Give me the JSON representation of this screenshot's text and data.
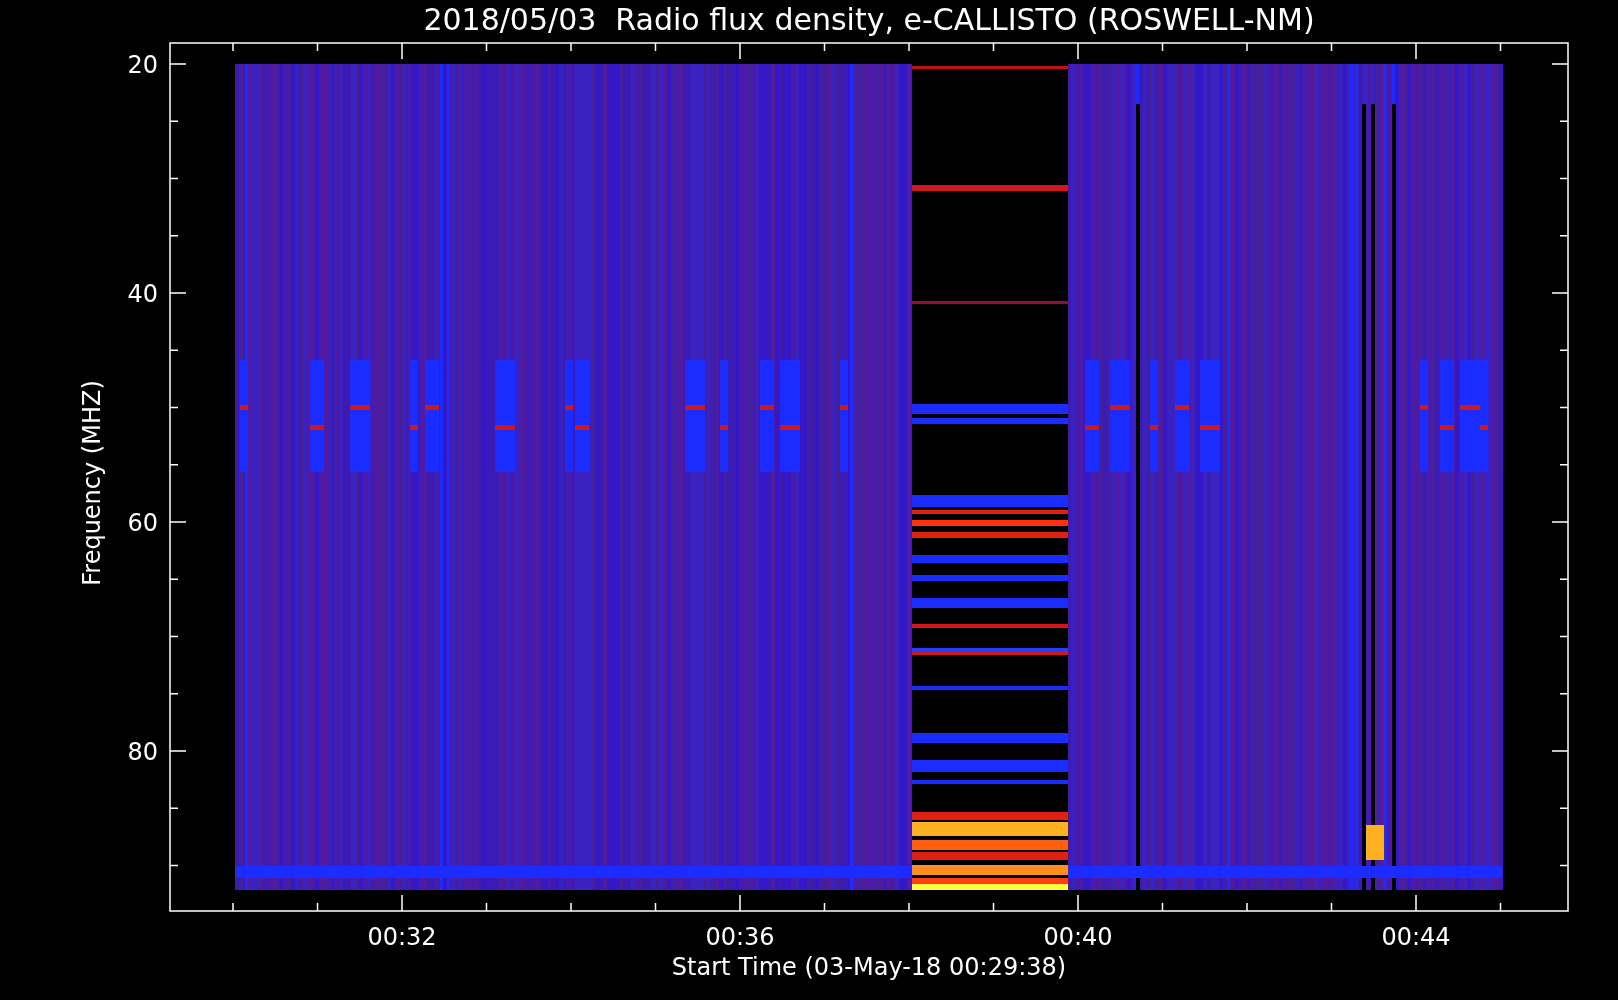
{
  "chart": {
    "title": "2018/05/03  Radio flux density, e-CALLISTO (ROSWELL-NM)",
    "y_axis": {
      "label": "Frequency (MHZ)",
      "ticks": [
        "20",
        "40",
        "60",
        "80"
      ]
    },
    "x_axis": {
      "label": "Start Time (03-May-18 00:29:38)",
      "ticks": [
        "00:32",
        "00:36",
        "00:40",
        "00:44"
      ]
    }
  }
}
